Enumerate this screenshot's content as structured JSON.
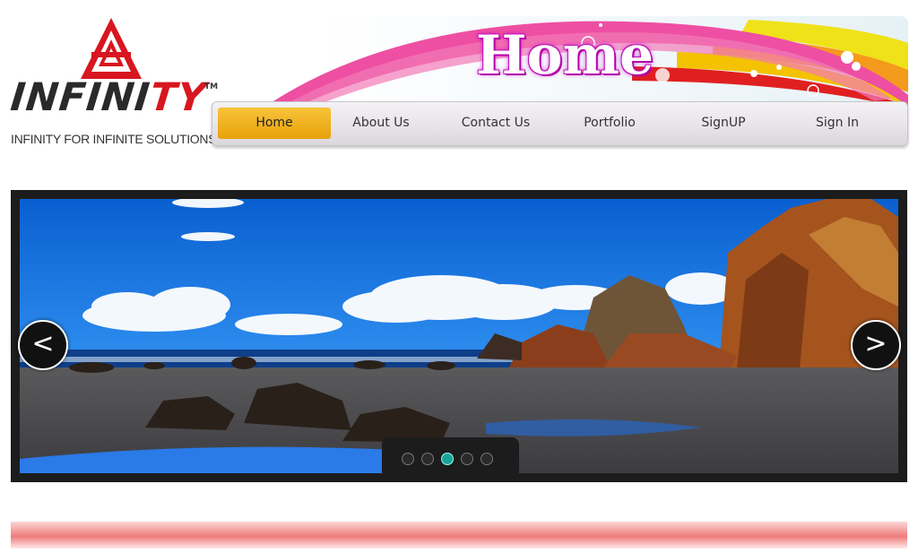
{
  "brand": {
    "name_part1": "INFINI",
    "name_part2": "TY",
    "trademark": "TM",
    "tagline": "INFINITY FOR INFINITE SOLUTIONS",
    "accent_color": "#d8161f"
  },
  "header": {
    "title": "Home"
  },
  "nav": {
    "items": [
      {
        "label": "Home",
        "active": true
      },
      {
        "label": "About Us",
        "active": false
      },
      {
        "label": "Contact Us",
        "active": false
      },
      {
        "label": "Portfolio",
        "active": false
      },
      {
        "label": "SignUP",
        "active": false
      },
      {
        "label": "Sign In",
        "active": false
      }
    ]
  },
  "slider": {
    "prev_icon": "chevron-left-icon",
    "next_icon": "chevron-right-icon",
    "prev_symbol": "<",
    "next_symbol": ">",
    "slide_count": 5,
    "active_slide": 3,
    "image_subject": "beach-with-rocks"
  },
  "colors": {
    "nav_active": "#f0b020",
    "dot_active": "#1aa398",
    "bottom_bar": "#ee7b7b"
  }
}
